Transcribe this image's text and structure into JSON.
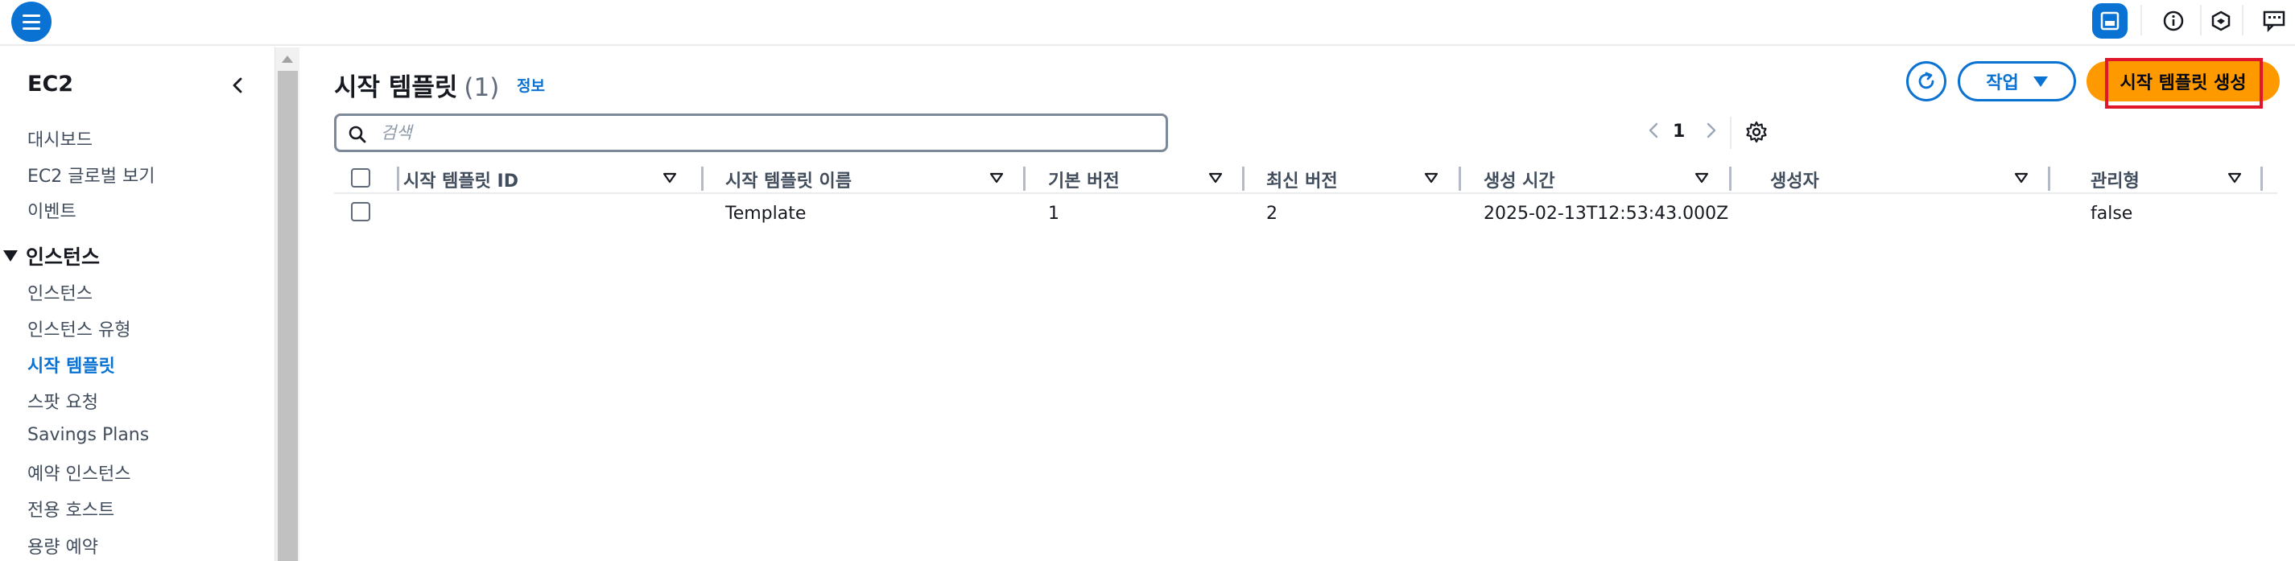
{
  "colors": {
    "primary": "#0972d3",
    "create_button": "#ff9900",
    "highlight_outline": "#e0162b"
  },
  "topbar": {
    "icons": [
      "menu-icon",
      "panel-icon",
      "info-icon",
      "notifications-icon",
      "feedback-icon"
    ]
  },
  "sidebar": {
    "title": "EC2",
    "items_top": [
      {
        "label": "대시보드"
      },
      {
        "label": "EC2 글로벌 보기"
      },
      {
        "label": "이벤트"
      }
    ],
    "section": "인스턴스",
    "items_instances": [
      {
        "label": "인스턴스"
      },
      {
        "label": "인스턴스 유형"
      },
      {
        "label": "시작 템플릿",
        "active": true
      },
      {
        "label": "스팟 요청"
      },
      {
        "label": "Savings Plans"
      },
      {
        "label": "예약 인스턴스"
      },
      {
        "label": "전용 호스트"
      },
      {
        "label": "용량 예약"
      }
    ]
  },
  "header": {
    "title": "시작 템플릿",
    "count": "(1)",
    "info_link": "정보",
    "actions_label": "작업",
    "create_label": "시작 템플릿 생성"
  },
  "search": {
    "placeholder": "검색",
    "value": ""
  },
  "pagination": {
    "current_page": "1"
  },
  "table": {
    "columns": [
      "시작 템플릿 ID",
      "시작 템플릿 이름",
      "기본 버전",
      "최신 버전",
      "생성 시간",
      "생성자",
      "관리형"
    ],
    "rows": [
      {
        "id": "",
        "name": "Template",
        "default_version": "1",
        "latest_version": "2",
        "created": "2025-02-13T12:53:43.000Z",
        "owner": "",
        "managed": "false"
      }
    ]
  }
}
